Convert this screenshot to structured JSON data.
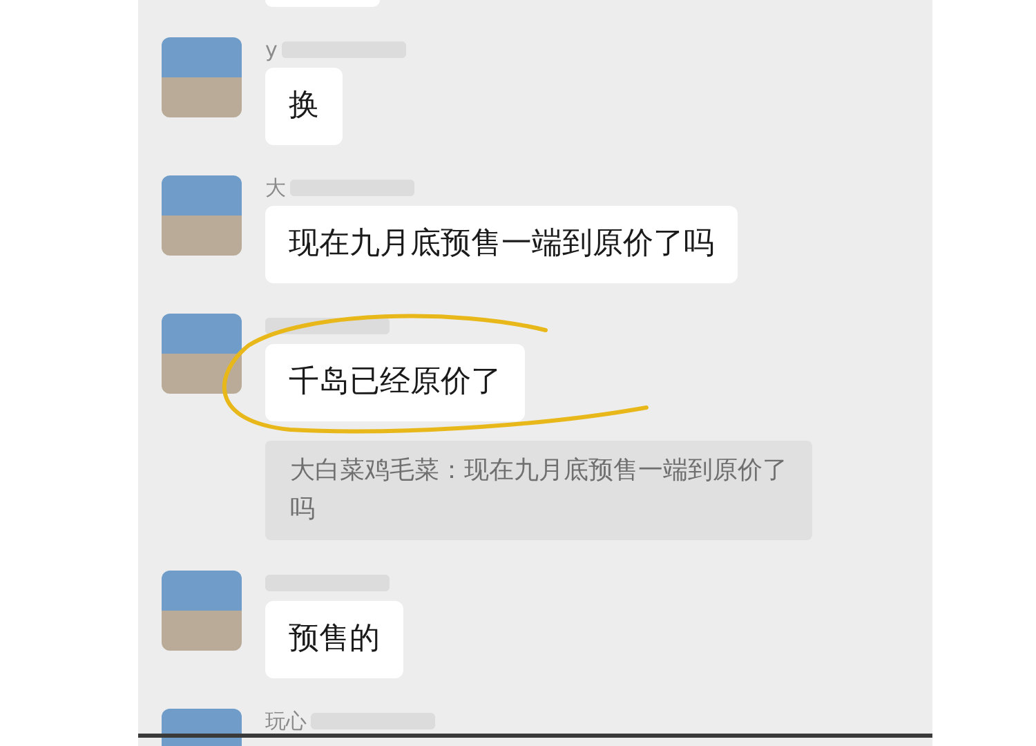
{
  "messages": [
    {
      "name": "y",
      "text": "换"
    },
    {
      "name": "大",
      "text": "现在九月底预售一端到原价了吗"
    },
    {
      "text": "千岛已经原价了",
      "highlighted": true,
      "quote": "大白菜鸡毛菜：现在九月底预售一端到原价了吗"
    },
    {
      "text": "预售的"
    },
    {
      "name": "玩心"
    }
  ]
}
